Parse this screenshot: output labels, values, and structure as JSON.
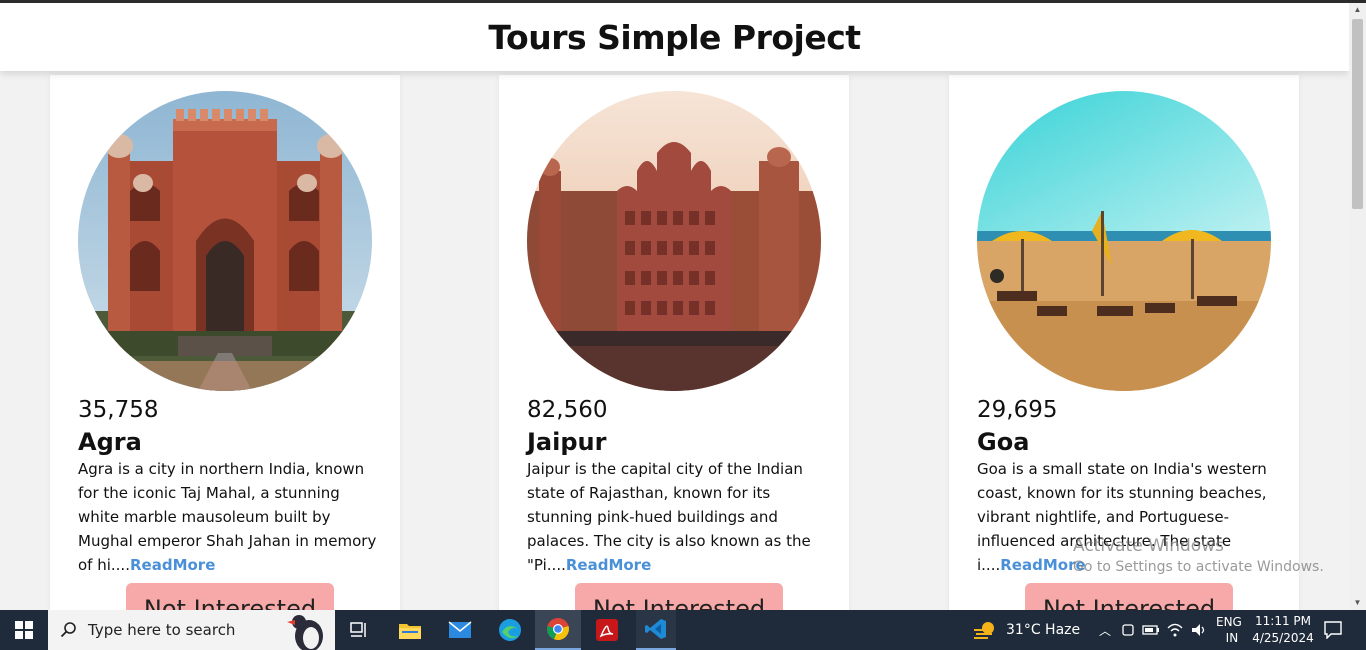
{
  "page": {
    "title": "Tours Simple Project"
  },
  "tours": [
    {
      "count": "35,758",
      "city": "Agra",
      "description": "Agra is a city in northern India, known for the iconic Taj Mahal, a stunning white marble mausoleum built by Mughal emperor Shah Jahan in memory of hi....",
      "read_more": "ReadMore",
      "button": "Not Interested",
      "image": "red-sandstone-gateway"
    },
    {
      "count": "82,560",
      "city": "Jaipur",
      "description": "Jaipur is the capital city of the Indian state of Rajasthan, known for its stunning pink-hued buildings and palaces. The city is also known as the \"Pi....",
      "read_more": "ReadMore",
      "button": "Not Interested",
      "image": "hawa-mahal-palace"
    },
    {
      "count": "29,695",
      "city": "Goa",
      "description": "Goa is a small state on India's western coast, known for its stunning beaches, vibrant nightlife, and Portuguese-influenced architecture. The state i....",
      "read_more": "ReadMore",
      "button": "Not Interested",
      "image": "beach-umbrellas"
    }
  ],
  "watermark": {
    "line1": "Activate Windows",
    "line2": "Go to Settings to activate Windows."
  },
  "taskbar": {
    "search_placeholder": "Type here to search",
    "weather": "31°C  Haze",
    "lang_top": "ENG",
    "lang_bottom": "IN",
    "time": "11:11 PM",
    "date": "4/25/2024"
  }
}
